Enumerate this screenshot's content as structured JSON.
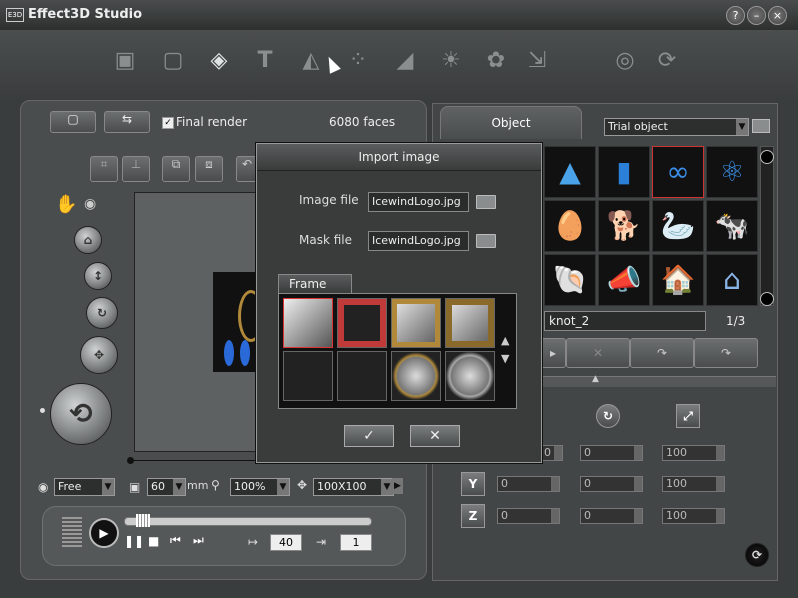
{
  "app": {
    "title": "Effect3D Studio",
    "logo": "E3D"
  },
  "window_buttons": {
    "help": "?",
    "minimize": "–",
    "close": "×"
  },
  "toolbar": {
    "tools": [
      "box-icon",
      "frame-icon",
      "shape-icon",
      "text-3d-icon",
      "paint-icon",
      "dots-icon",
      "fill-icon",
      "light-icon",
      "gear-page-icon",
      "export-icon",
      "web-icon",
      "refresh-icon"
    ],
    "glyphs": [
      "▣",
      "▢",
      "◈",
      "T",
      "◭",
      "⁘",
      "◢",
      "☀",
      "✿",
      "⇲",
      "◎",
      "⟳"
    ]
  },
  "left_panel": {
    "final_render_label": "Final render",
    "faces": "6080 faces",
    "view_select": "Free",
    "distance_value": "60",
    "distance_unit": "mm",
    "zoom_value": "100%",
    "size_value": "100X100",
    "frames_total": "40",
    "current_frame": "1"
  },
  "right_panel": {
    "tab_label": "Object",
    "object_select": "Trial object",
    "object_name": "knot_2",
    "page": "1/3",
    "axes": [
      "Y",
      "Z"
    ],
    "rows": [
      [
        "0",
        "0",
        "100"
      ],
      [
        "0",
        "0",
        "100"
      ],
      [
        "0",
        "0",
        "100"
      ]
    ],
    "thumbnails": [
      "▲",
      "▮",
      "∞",
      "⚛",
      "🥚",
      "🐕",
      "🦢",
      "🐄",
      "🐚",
      "📣",
      "🏠",
      "⌂"
    ]
  },
  "dialog": {
    "title": "Import image",
    "image_file_label": "Image file",
    "image_file_value": "IcewindLogo.jpg",
    "mask_file_label": "Mask file",
    "mask_file_value": "IcewindLogo.jpg",
    "frame_tab": "Frame",
    "ok": "✓",
    "cancel": "✕"
  }
}
